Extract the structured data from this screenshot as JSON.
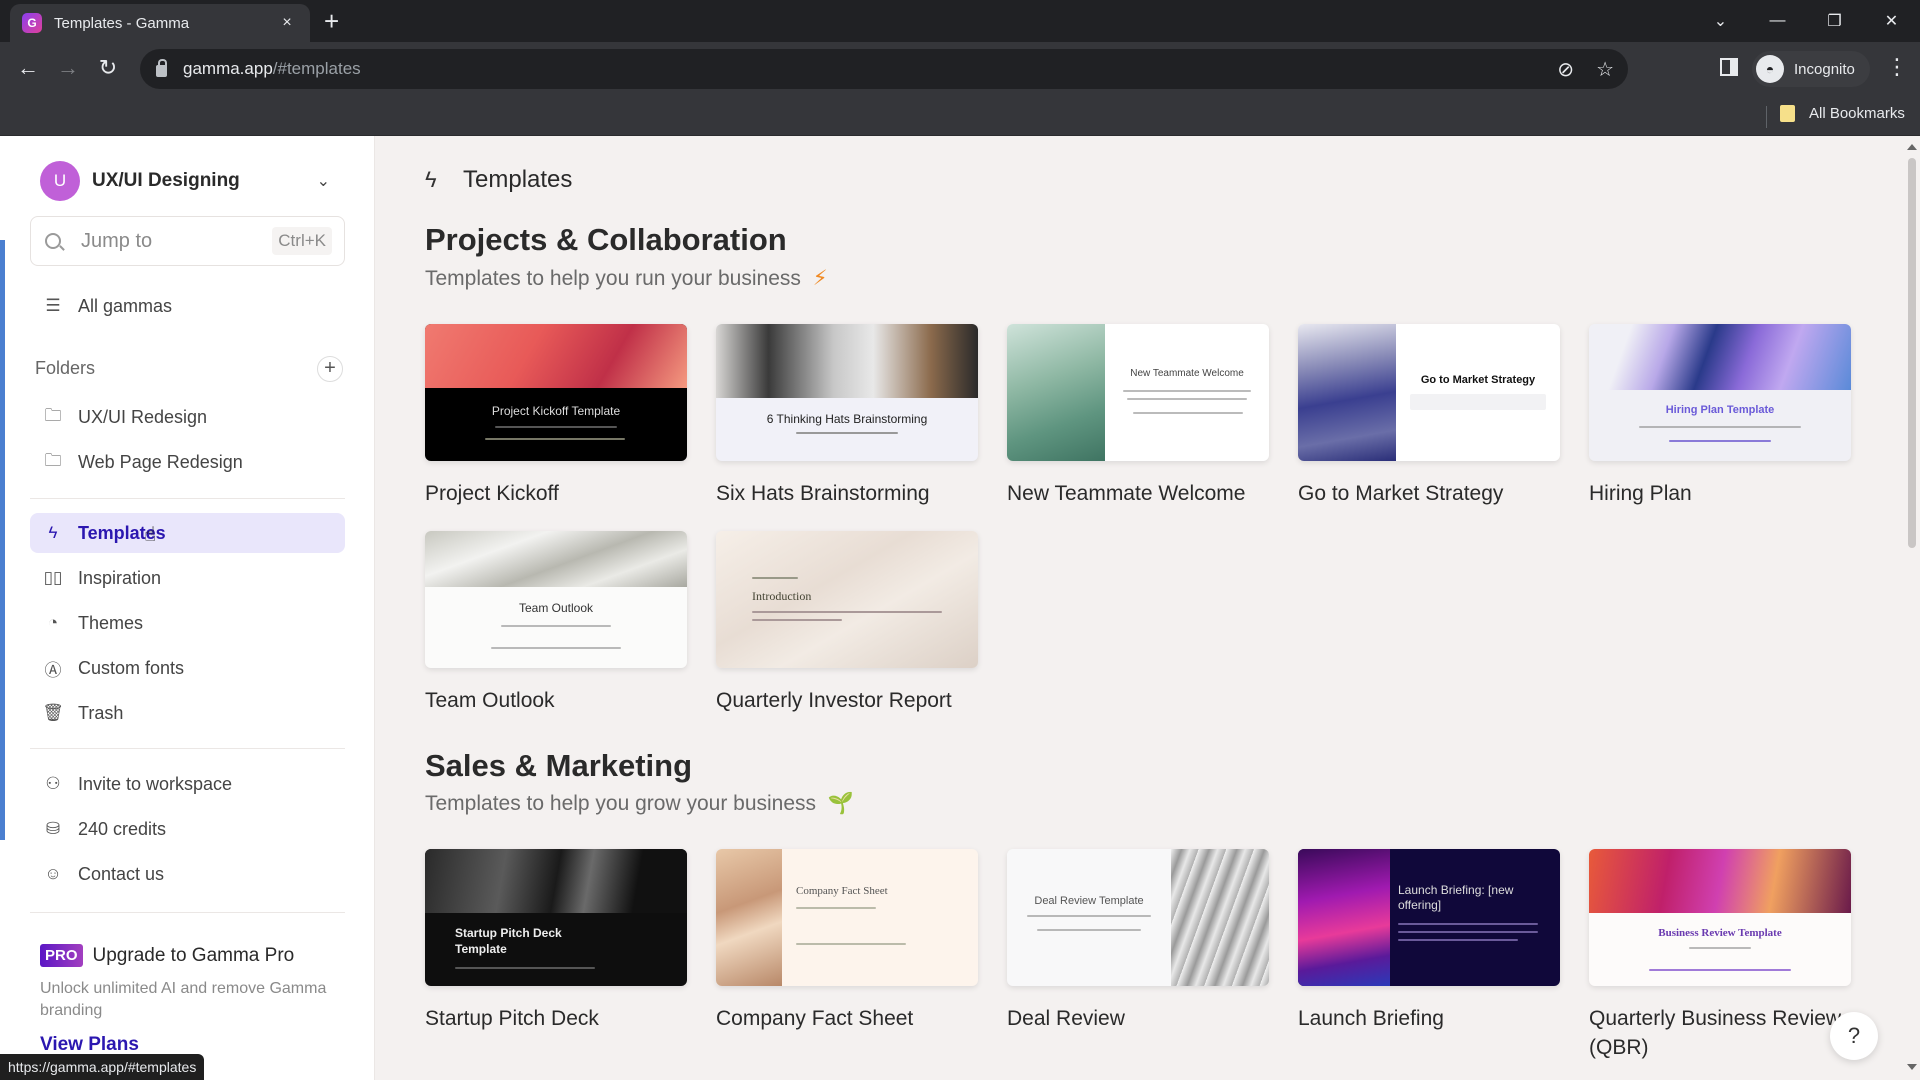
{
  "browser": {
    "tab_title": "Templates - Gamma",
    "tab_favicon": "gamma-logo-icon",
    "new_tab_label": "+",
    "close_tab_label": "×",
    "url_host": "gamma.app",
    "url_path": "/#templates",
    "profile_label": "Incognito",
    "bookmarks_label": "All Bookmarks",
    "status_url": "https://gamma.app/#templates",
    "icons": [
      "back-icon",
      "forward-icon",
      "reload-icon",
      "lock-icon",
      "eye-off-icon",
      "star-icon",
      "side-panel-icon",
      "incognito-icon",
      "kebab-menu-icon",
      "tab-search-icon",
      "minimize-icon",
      "restore-icon",
      "close-window-icon"
    ]
  },
  "sidebar": {
    "workspace": {
      "initial": "U",
      "name": "UX/UI Designing",
      "avatar_color": "#c060d8"
    },
    "search": {
      "placeholder": "Jump to",
      "shortcut": "Ctrl+K"
    },
    "all_gammas": "All gammas",
    "folders_heading": "Folders",
    "folders": [
      {
        "label": "UX/UI Redesign",
        "icon": "folder-icon"
      },
      {
        "label": "Web Page Redesign",
        "icon": "folder-icon"
      }
    ],
    "nav": [
      {
        "label": "Templates",
        "icon": "lightning-icon",
        "active": true
      },
      {
        "label": "Inspiration",
        "icon": "book-open-icon"
      },
      {
        "label": "Themes",
        "icon": "palette-icon"
      },
      {
        "label": "Custom fonts",
        "icon": "font-icon"
      },
      {
        "label": "Trash",
        "icon": "trash-icon"
      }
    ],
    "footer_nav": [
      {
        "label": "Invite to workspace",
        "icon": "user-plus-icon"
      },
      {
        "label": "240 credits",
        "icon": "coins-icon"
      },
      {
        "label": "Contact us",
        "icon": "chat-smile-icon"
      }
    ],
    "upgrade": {
      "badge": "PRO",
      "title": "Upgrade to Gamma Pro",
      "description": "Unlock unlimited AI and remove Gamma branding",
      "cta": "View Plans"
    },
    "accent_color": "#2b17b0"
  },
  "main": {
    "page_title": "Templates",
    "sections": [
      {
        "title": "Projects & Collaboration",
        "subtitle": "Templates to help you run your business",
        "emoji": "⚡",
        "templates": [
          {
            "label": "Project Kickoff",
            "thumb_title": "Project Kickoff Template"
          },
          {
            "label": "Six Hats Brainstorming",
            "thumb_title": "6 Thinking Hats Brainstorming"
          },
          {
            "label": "New Teammate Welcome",
            "thumb_title": "New Teammate Welcome"
          },
          {
            "label": "Go to Market Strategy",
            "thumb_title": "Go to Market Strategy"
          },
          {
            "label": "Hiring Plan",
            "thumb_title": "Hiring Plan Template"
          },
          {
            "label": "Team Outlook",
            "thumb_title": "Team Outlook"
          },
          {
            "label": "Quarterly Investor Report",
            "thumb_title": "Introduction"
          }
        ]
      },
      {
        "title": "Sales & Marketing",
        "subtitle": "Templates to help you grow your business",
        "emoji": "🌱",
        "templates": [
          {
            "label": "Startup Pitch Deck",
            "thumb_title": "Startup Pitch Deck Template"
          },
          {
            "label": "Company Fact Sheet",
            "thumb_title": "Company Fact Sheet"
          },
          {
            "label": "Deal Review",
            "thumb_title": "Deal Review Template"
          },
          {
            "label": "Launch Briefing",
            "thumb_title": "Launch Briefing: [new offering]"
          },
          {
            "label": "Quarterly Business Review (QBR)",
            "thumb_title": "Business Review Template"
          }
        ]
      }
    ],
    "help_label": "?"
  }
}
